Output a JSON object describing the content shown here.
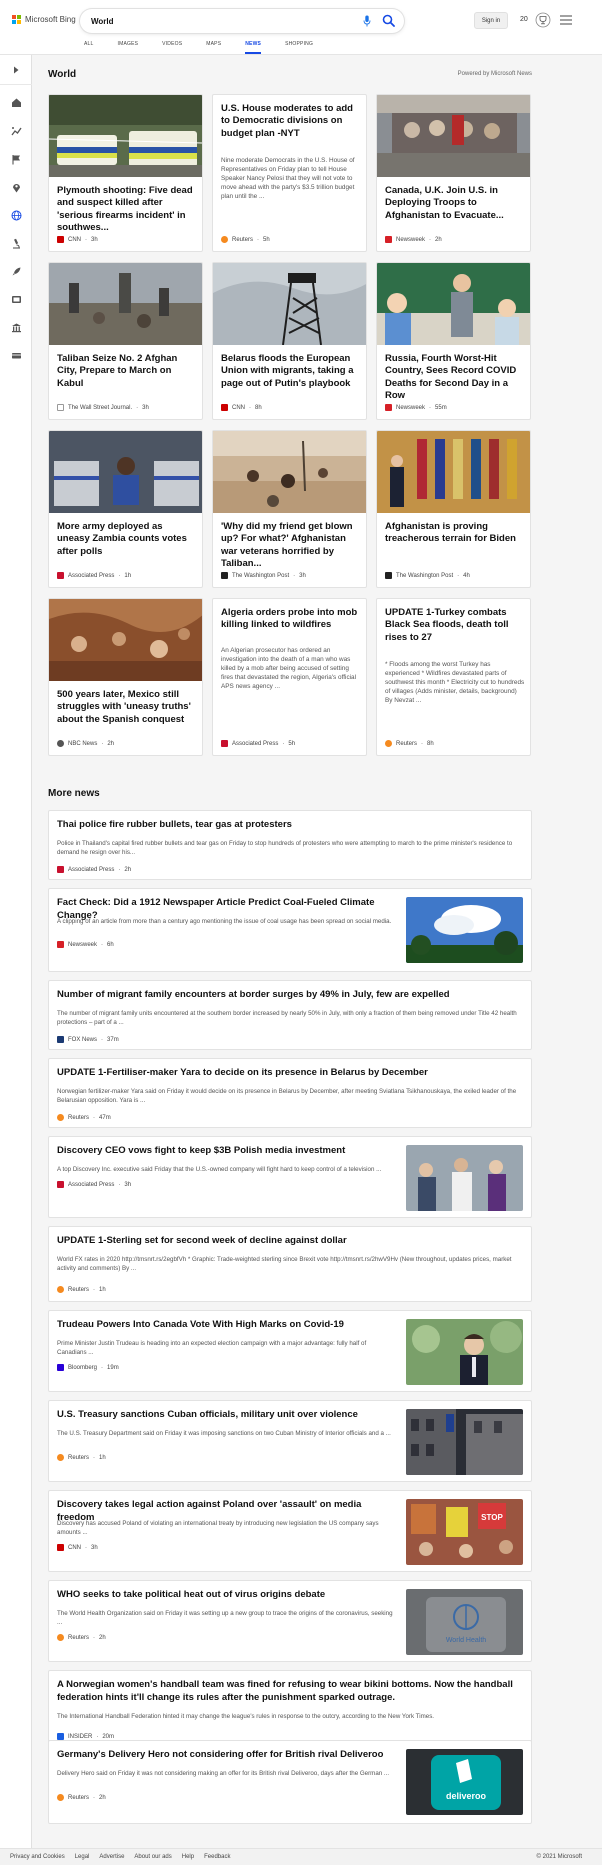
{
  "header": {
    "brand": "Microsoft Bing",
    "search_value": "World",
    "signin_label": "Sign in",
    "rewards_count": "20",
    "colors": {
      "accent": "#174ae4",
      "logo": [
        "#f25022",
        "#7fba00",
        "#00a4ef",
        "#ffb900"
      ]
    }
  },
  "tabs": [
    {
      "label": "ALL"
    },
    {
      "label": "IMAGES"
    },
    {
      "label": "VIDEOS"
    },
    {
      "label": "MAPS"
    },
    {
      "label": "NEWS",
      "active": true
    },
    {
      "label": "SHOPPING"
    }
  ],
  "rail_icons": [
    "expand-icon",
    "home-icon",
    "trending-icon",
    "flag-icon",
    "location-icon",
    "globe-icon",
    "microscope-icon",
    "rocket-icon",
    "entertainment-icon",
    "business-icon",
    "money-icon"
  ],
  "section": {
    "title": "World",
    "powered_by": "Powered by Microsoft News"
  },
  "cards": [
    {
      "title": "Plymouth shooting: Five dead and suspect killed after 'serious firearms incident' in southwes...",
      "source": "CNN",
      "age": "3h",
      "snippet": ""
    },
    {
      "title": "U.S. House moderates to add to Democratic divisions on budget plan -NYT",
      "source": "Reuters",
      "age": "5h",
      "snippet": "Nine moderate Democrats in the U.S. House of Representatives on Friday plan to tell House Speaker Nancy Pelosi that they will not vote to move ahead with the party's $3.5 trillion budget plan until the ..."
    },
    {
      "title": "Canada, U.K. Join U.S. in Deploying Troops to Afghanistan to Evacuate...",
      "source": "Newsweek",
      "age": "2h",
      "snippet": ""
    },
    {
      "title": "Taliban Seize No. 2 Afghan City, Prepare to March on Kabul",
      "source": "The Wall Street Journal.",
      "age": "3h",
      "snippet": ""
    },
    {
      "title": "Belarus floods the European Union with migrants, taking a page out of Putin's playbook",
      "source": "CNN",
      "age": "8h",
      "snippet": ""
    },
    {
      "title": "Russia, Fourth Worst-Hit Country, Sees Record COVID Deaths for Second Day in a Row",
      "source": "Newsweek",
      "age": "55m",
      "snippet": ""
    },
    {
      "title": "More army deployed as uneasy Zambia counts votes after polls",
      "source": "Associated Press",
      "age": "1h",
      "snippet": ""
    },
    {
      "title": "'Why did my friend get blown up? For what?' Afghanistan war veterans horrified by Taliban...",
      "source": "The Washington Post",
      "age": "3h",
      "snippet": ""
    },
    {
      "title": "Afghanistan is proving treacherous terrain for Biden",
      "source": "The Washington Post",
      "age": "4h",
      "snippet": ""
    },
    {
      "title": "500 years later, Mexico still struggles with 'uneasy truths' about the Spanish conquest",
      "source": "NBC News",
      "age": "2h",
      "snippet": ""
    },
    {
      "title": "Algeria orders probe into mob killing linked to wildfires",
      "source": "Associated Press",
      "age": "5h",
      "snippet": "An Algerian prosecutor has ordered an investigation into the death of a man who was killed by a mob after being accused of setting fires that devastated the region, Algeria's official APS news agency ..."
    },
    {
      "title": "UPDATE 1-Turkey combats Black Sea floods, death toll rises to 27",
      "source": "Reuters",
      "age": "8h",
      "snippet": "* Floods among the worst Turkey has experienced * Wildfires devastated parts of southwest this month * Electricity cut to hundreds of villages (Adds minister, details, background) By Nevzat ..."
    }
  ],
  "more_news": {
    "title": "More news",
    "items": [
      {
        "title": "Thai police fire rubber bullets, tear gas at protesters",
        "snippet": "Police in Thailand's capital fired rubber bullets and tear gas on Friday to stop hundreds of protesters who were attempting to march to the prime minister's residence to demand he resign over his...",
        "source": "Associated Press",
        "age": "2h"
      },
      {
        "title": "Fact Check: Did a 1912 Newspaper Article Predict Coal-Fueled Climate Change?",
        "snippet": "A clipping of an article from more than a century ago mentioning the issue of coal usage has been spread on social media.",
        "source": "Newsweek",
        "age": "6h"
      },
      {
        "title": "Number of migrant family encounters at border surges by 49% in July, few are expelled",
        "snippet": "The number of migrant family units encountered at the southern border increased by nearly 50% in July, with only a fraction of them being removed under Title 42 health protections – part of a ...",
        "source": "FOX News",
        "age": "37m"
      },
      {
        "title": "UPDATE 1-Fertiliser-maker Yara to decide on its presence in Belarus by December",
        "snippet": "Norwegian fertilizer-maker Yara said on Friday it would decide on its presence in Belarus by December, after meeting Sviatlana Tsikhanouskaya, the exiled leader of the Belarusian opposition. Yara is ...",
        "source": "Reuters",
        "age": "47m"
      },
      {
        "title": "Discovery CEO vows fight to keep $3B Polish media investment",
        "snippet": "A top Discovery Inc. executive said Friday that the U.S.-owned company will fight hard to keep control of a television ...",
        "source": "Associated Press",
        "age": "3h"
      },
      {
        "title": "UPDATE 1-Sterling set for second week of decline against dollar",
        "snippet": "World FX rates in 2020 http://tmsnrt.rs/2egbfVh * Graphic: Trade-weighted sterling since Brexit vote http://tmsnrt.rs/2hwV9Hv (New throughout, updates prices, market activity and comments) By ...",
        "source": "Reuters",
        "age": "1h"
      },
      {
        "title": "Trudeau Powers Into Canada Vote With High Marks on Covid-19",
        "snippet": "Prime Minister Justin Trudeau is heading into an expected election campaign with a major advantage: fully half of Canadians ...",
        "source": "Bloomberg",
        "age": "19m"
      },
      {
        "title": "U.S. Treasury sanctions Cuban officials, military unit over violence",
        "snippet": "The U.S. Treasury Department said on Friday it was imposing sanctions on two Cuban Ministry of Interior officials and a ...",
        "source": "Reuters",
        "age": "1h"
      },
      {
        "title": "Discovery takes legal action against Poland over 'assault' on media freedom",
        "snippet": "Discovery has accused Poland of violating an international treaty by introducing new legislation the US company says amounts ...",
        "source": "CNN",
        "age": "3h"
      },
      {
        "title": "WHO seeks to take political heat out of virus origins debate",
        "snippet": "The World Health Organization said on Friday it was setting up a new group to trace the origins of the coronavirus, seeking ...",
        "source": "Reuters",
        "age": "2h"
      },
      {
        "title": "A Norwegian women's handball team was fined for refusing to wear bikini bottoms. Now the handball federation hints it'll change its rules after the punishment sparked outrage.",
        "snippet": "The International Handball Federation hinted it may change the league's rules in response to the outcry, according to the New York Times.",
        "source": "INSIDER",
        "age": "20m"
      },
      {
        "title": "Germany's Delivery Hero not considering offer for British rival Deliveroo",
        "snippet": "Delivery Hero said on Friday it was not considering making an offer for its British rival Deliveroo, days after the German ...",
        "source": "Reuters",
        "age": "2h"
      }
    ]
  },
  "thumb_text": {
    "who_sign": "World Health",
    "deliveroo": "deliveroo",
    "protest_sign": "STOP"
  },
  "footer": {
    "links": [
      "Privacy and Cookies",
      "Legal",
      "Advertise",
      "About our ads",
      "Help",
      "Feedback"
    ],
    "copyright": "© 2021 Microsoft"
  },
  "source_colors": {
    "CNN": "#cc0000",
    "Reuters": "#f58a1f",
    "Newsweek": "#d62027",
    "The Wall Street Journal.": "#999999",
    "Associated Press": "#c8102e",
    "The Washington Post": "#222222",
    "NBC News": "#555555",
    "FOX News": "#1b3a73",
    "Bloomberg": "#2800d7",
    "INSIDER": "#1a5ee0"
  }
}
